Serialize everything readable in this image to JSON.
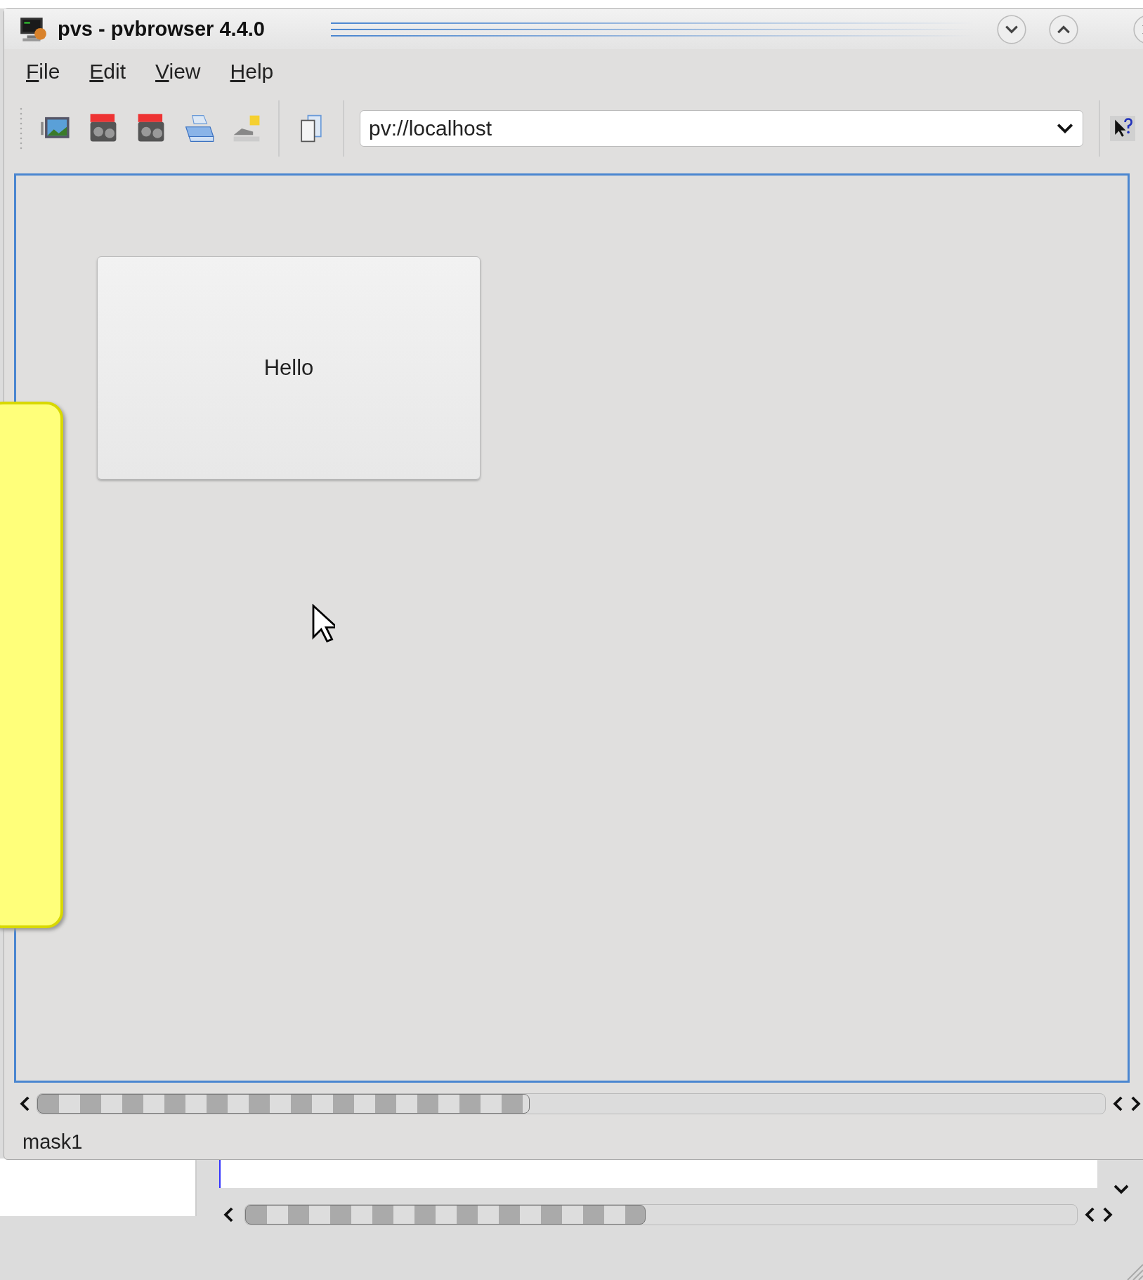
{
  "window": {
    "title": "pvs - pvbrowser 4.4.0"
  },
  "menu": [
    "File",
    "Edit",
    "View",
    "Help"
  ],
  "address": {
    "value": "pv://localhost"
  },
  "mask": {
    "button": "Hello"
  },
  "status_bar": "mask1"
}
